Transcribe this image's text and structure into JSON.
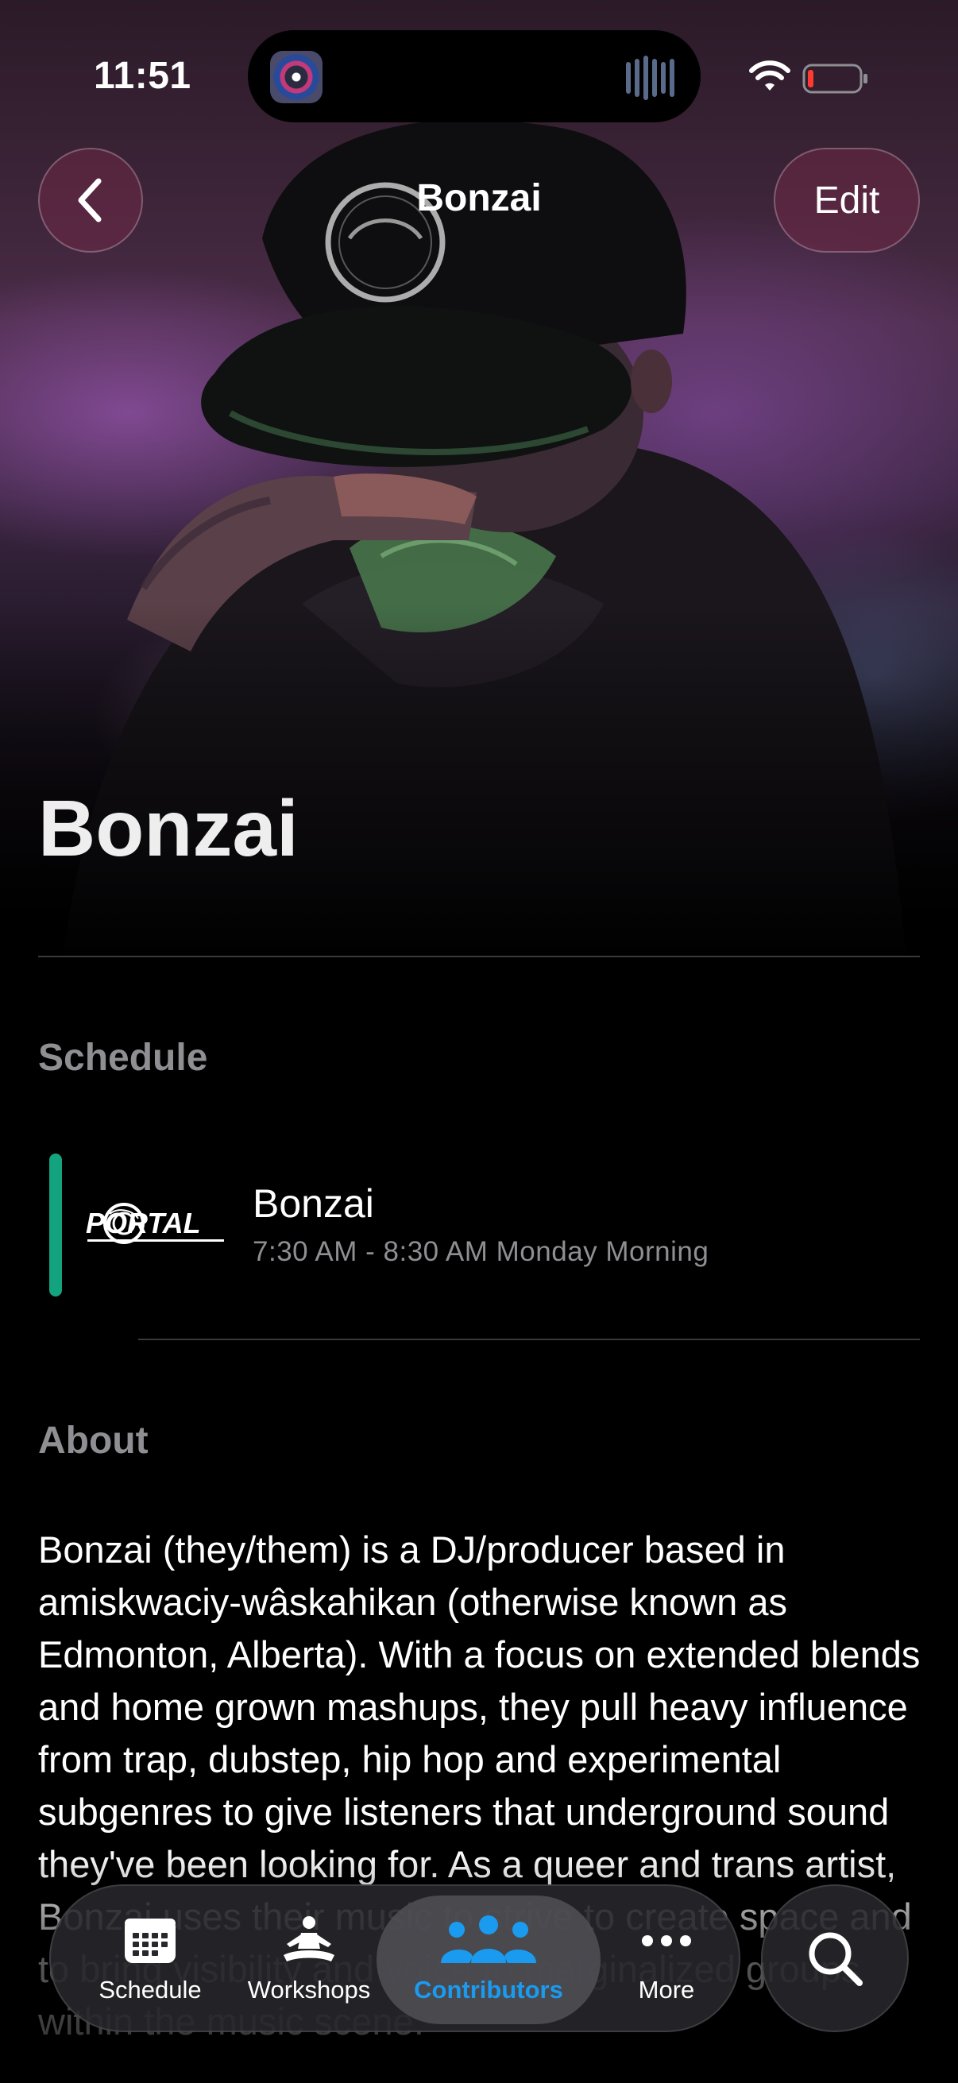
{
  "status_bar": {
    "time": "11:51"
  },
  "nav": {
    "title": "Bonzai",
    "edit_label": "Edit"
  },
  "hero": {
    "name": "Bonzai"
  },
  "schedule": {
    "heading": "Schedule",
    "items": [
      {
        "logo_text": "PORTAL",
        "title": "Bonzai",
        "time": "7:30 AM - 8:30 AM Monday Morning",
        "accent_color": "#14A37F"
      }
    ]
  },
  "about": {
    "heading": "About",
    "text": "Bonzai (they/them) is a DJ/producer based in amiskwaciy-wâskahikan (otherwise known as Edmonton, Alberta). With a focus on extended blends and home grown mashups, they pull heavy influence from trap, dubstep, hip hop and experimental subgenres to give listeners that underground sound they've been looking for. As a queer and trans artist, Bonzai uses their music to strive to create space and to bring visibility and voice to marginalized groups within the music scene."
  },
  "tabbar": {
    "tabs": [
      {
        "label": "Schedule",
        "icon": "calendar-icon",
        "selected": false
      },
      {
        "label": "Workshops",
        "icon": "meditation-icon",
        "selected": false
      },
      {
        "label": "Contributors",
        "icon": "people-icon",
        "selected": true
      },
      {
        "label": "More",
        "icon": "ellipsis-icon",
        "selected": false
      }
    ],
    "search_icon": "search-icon",
    "selected_color": "#1A9BF0"
  }
}
